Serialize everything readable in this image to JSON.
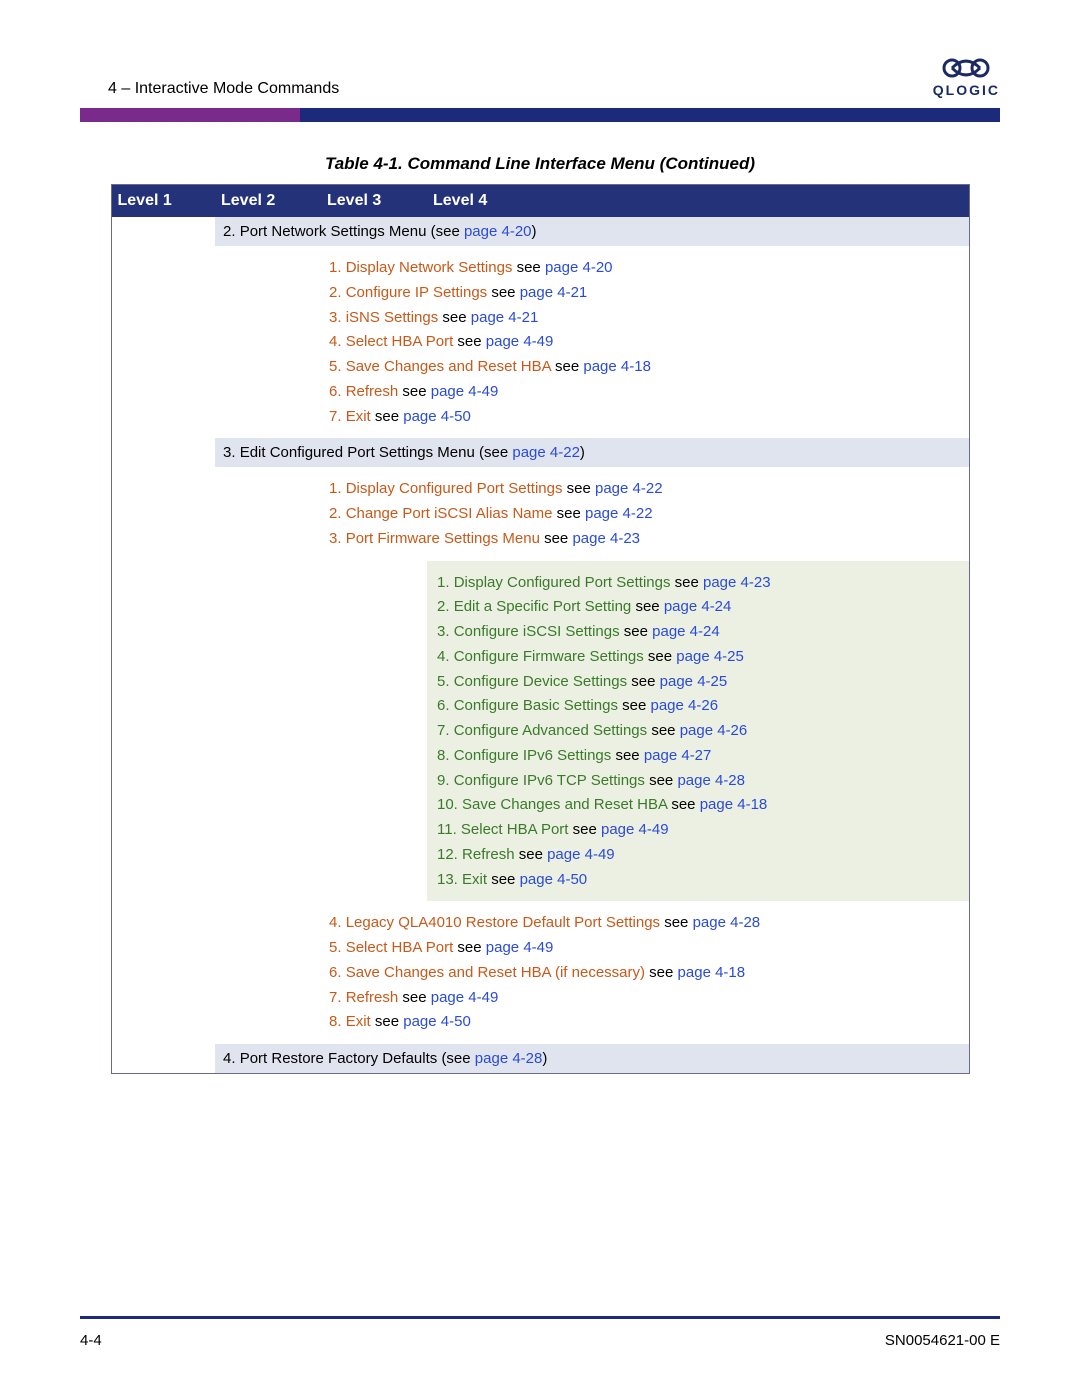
{
  "header": {
    "section": "4 – Interactive Mode Commands",
    "logo_text": "QLOGIC"
  },
  "caption": "Table 4-1. Command Line Interface Menu (Continued)",
  "columns": {
    "c1": "Level 1",
    "c2": "Level 2",
    "c3": "Level 3",
    "c4": "Level 4"
  },
  "l2a_num": "2.",
  "l2a_txt": "Port Network Settings Menu",
  "l2a_see": " (see ",
  "l2a_ref": "page 4-20",
  "l2a_close": ")",
  "l3a": {
    "i1_n": "1. ",
    "i1_t": "Display Network Settings",
    "i1_s": " see ",
    "i1_r": "page 4-20",
    "i2_n": "2. ",
    "i2_t": "Configure IP Settings",
    "i2_s": " see ",
    "i2_r": "page 4-21",
    "i3_n": "3. ",
    "i3_t": "iSNS Settings",
    "i3_s": " see ",
    "i3_r": "page 4-21",
    "i4_n": "4. ",
    "i4_t": "Select HBA Port",
    "i4_s": " see ",
    "i4_r": "page 4-49",
    "i5_n": "5. ",
    "i5_t": "Save Changes and Reset HBA",
    "i5_s": " see ",
    "i5_r": "page 4-18",
    "i6_n": "6. ",
    "i6_t": "Refresh",
    "i6_s": " see ",
    "i6_r": "page 4-49",
    "i7_n": "7. ",
    "i7_t": "Exit",
    "i7_s": " see ",
    "i7_r": "page 4-50"
  },
  "l2b_num": "3.",
  "l2b_txt": "Edit Configured Port Settings Menu",
  "l2b_see": " (see ",
  "l2b_ref": "page 4-22",
  "l2b_close": ")",
  "l3b": {
    "i1_n": "1. ",
    "i1_t": "Display Configured Port Settings",
    "i1_s": " see ",
    "i1_r": "page 4-22",
    "i2_n": "2. ",
    "i2_t": "Change Port iSCSI Alias Name",
    "i2_s": " see ",
    "i2_r": "page 4-22",
    "i3_n": "3. ",
    "i3_t": "Port Firmware Settings Menu",
    "i3_s": " see ",
    "i3_r": "page 4-23"
  },
  "l4": {
    "i1_n": "1. ",
    "i1_t": "Display Configured Port Settings",
    "i1_s": " see ",
    "i1_r": "page 4-23",
    "i2_n": "2. ",
    "i2_t": "Edit a Specific Port Setting",
    "i2_s": " see ",
    "i2_r": "page 4-24",
    "i3_n": "3. ",
    "i3_t": "Configure iSCSI Settings",
    "i3_s": " see ",
    "i3_r": "page 4-24",
    "i4_n": "4. ",
    "i4_t": "Configure Firmware Settings",
    "i4_s": " see ",
    "i4_r": "page 4-25",
    "i5_n": "5. ",
    "i5_t": "Configure Device Settings",
    "i5_s": " see ",
    "i5_r": "page 4-25",
    "i6_n": "6. ",
    "i6_t": "Configure Basic Settings",
    "i6_s": " see ",
    "i6_r": "page 4-26",
    "i7_n": "7. ",
    "i7_t": "Configure Advanced Settings",
    "i7_s": " see ",
    "i7_r": "page 4-26",
    "i8_n": "8. ",
    "i8_t": "Configure IPv6 Settings",
    "i8_s": " see ",
    "i8_r": "page 4-27",
    "i9_n": "9. ",
    "i9_t": "Configure IPv6 TCP Settings",
    "i9_s": " see ",
    "i9_r": "page 4-28",
    "i10_n": "10. ",
    "i10_t": "Save Changes and Reset HBA",
    "i10_s": " see ",
    "i10_r": "page 4-18",
    "i11_n": "11. ",
    "i11_t": "Select HBA Port",
    "i11_s": " see ",
    "i11_r": "page 4-49",
    "i12_n": "12. ",
    "i12_t": "Refresh",
    "i12_s": " see ",
    "i12_r": "page 4-49",
    "i13_n": "13. ",
    "i13_t": "Exit",
    "i13_s": " see ",
    "i13_r": "page 4-50"
  },
  "l3c": {
    "i4_n": "4. ",
    "i4_t": "Legacy QLA4010 Restore Default Port Settings",
    "i4_s": " see ",
    "i4_r": "page 4-28",
    "i5_n": "5. ",
    "i5_t": "Select HBA Port",
    "i5_s": " see ",
    "i5_r": "page 4-49",
    "i6_n": "6. ",
    "i6_t": "Save Changes and Reset HBA (if necessary)",
    "i6_s": " see ",
    "i6_r": "page 4-18",
    "i7_n": "7. ",
    "i7_t": "Refresh",
    "i7_s": " see ",
    "i7_r": "page 4-49",
    "i8_n": "8. ",
    "i8_t": "Exit",
    "i8_s": " see ",
    "i8_r": "page 4-50"
  },
  "l2c_num": "4.",
  "l2c_txt": "Port Restore Factory Defaults",
  "l2c_see": " (see ",
  "l2c_ref": "page 4-28",
  "l2c_close": ")",
  "footer": {
    "page": "4-4",
    "doc": "SN0054621-00  E"
  }
}
